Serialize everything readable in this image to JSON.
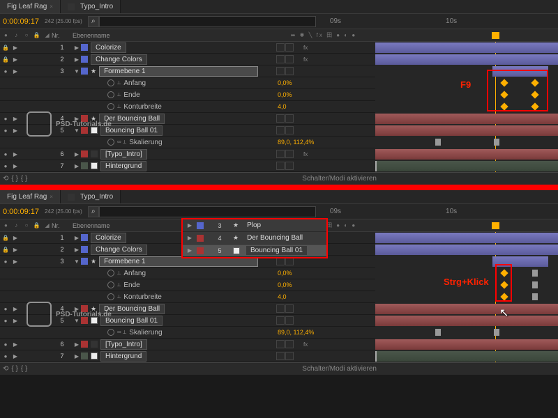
{
  "tabs": {
    "active": "Fig Leaf Rag",
    "inactive": "Typo_Intro"
  },
  "timecode": "0:00:09:17",
  "fps": "242 (25.00 fps)",
  "time_ruler": {
    "t1": "09s",
    "t2": "10s"
  },
  "headers": {
    "nr": "Nr.",
    "name": "Ebenenname"
  },
  "layers": [
    {
      "nr": "1",
      "name": "Colorize",
      "color": "c-b",
      "fx": "fx"
    },
    {
      "nr": "2",
      "name": "Change Colors",
      "color": "c-b",
      "fx": "fx"
    },
    {
      "nr": "3",
      "name": "Formebene 1",
      "color": "c-b",
      "shape": true,
      "selected": true
    },
    {
      "nr": "4",
      "name": "Der Bouncing Ball",
      "color": "c-r",
      "shape": true
    },
    {
      "nr": "5",
      "name": "Bouncing Ball 01",
      "color": "c-r"
    },
    {
      "nr": "6",
      "name": "[Typo_Intro]",
      "color": "c-r",
      "fx": "fx"
    },
    {
      "nr": "7",
      "name": "Hintergrund",
      "color": "c-g"
    }
  ],
  "props": {
    "anfang": "Anfang",
    "ende": "Ende",
    "konturbreite": "Konturbreite",
    "skalierung": "Skalierung"
  },
  "vals": {
    "anfang": "0,0%",
    "ende": "0,0%",
    "konturbreite": "4,0",
    "skalierung": "89,0, 112,4%"
  },
  "popup": {
    "items": [
      {
        "nr": "3",
        "name": "Plop",
        "color": "c-b",
        "star": true
      },
      {
        "nr": "4",
        "name": "Der Bouncing Ball",
        "color": "c-r",
        "star": true
      },
      {
        "nr": "5",
        "name": "Bouncing Ball 01",
        "color": "c-r",
        "selected": true
      }
    ]
  },
  "annotations": {
    "top": "F9",
    "bottom": "Strg+Klick"
  },
  "footer": "Schalter/Modi aktivieren",
  "watermark": "PSD-Tutorials.de"
}
